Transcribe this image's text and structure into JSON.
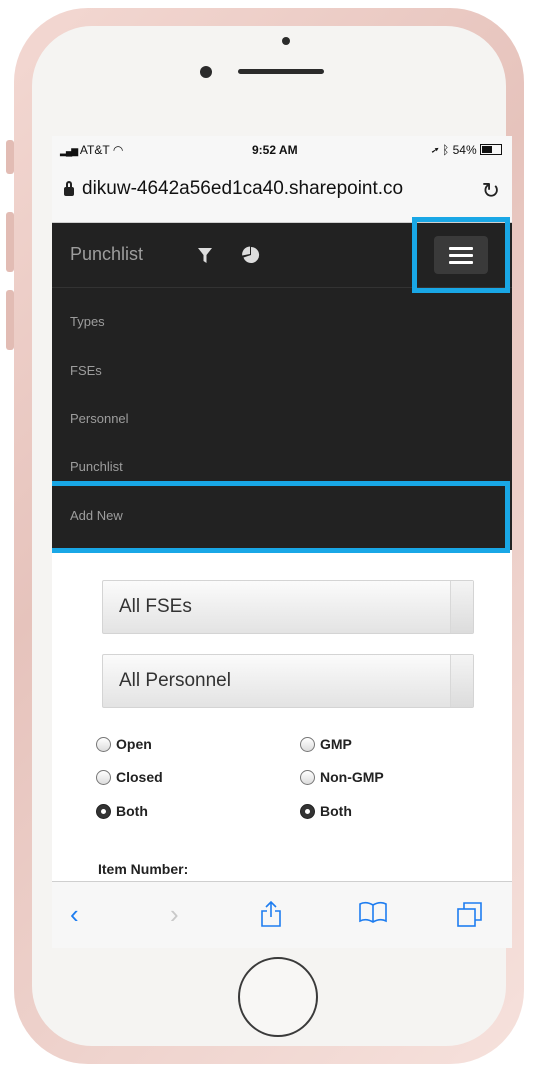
{
  "status_bar": {
    "carrier": "AT&T",
    "time": "9:52 AM",
    "battery": "54%"
  },
  "browser": {
    "url": "dikuw-4642a56ed1ca40.sharepoint.co"
  },
  "navbar": {
    "brand": "Punchlist",
    "icons": [
      "filter-icon",
      "pie-chart-icon",
      "hamburger-menu-icon"
    ]
  },
  "menu": {
    "items": [
      "Types",
      "FSEs",
      "Personnel",
      "Punchlist",
      "Add New"
    ]
  },
  "filters": {
    "fse_select": "All FSEs",
    "personnel_select": "All Personnel",
    "status_group": {
      "options": [
        "Open",
        "Closed",
        "Both"
      ],
      "selected": "Both"
    },
    "gmp_group": {
      "options": [
        "GMP",
        "Non-GMP",
        "Both"
      ],
      "selected": "Both"
    },
    "item_number_label": "Item Number:",
    "item_number_value": ""
  },
  "toolbar": {
    "icons": [
      "back-icon",
      "forward-icon",
      "share-icon",
      "bookmarks-icon",
      "tabs-icon"
    ]
  },
  "colors": {
    "navbar_bg": "#222222",
    "highlight": "#19a7e6",
    "ios_blue": "#1e7df0"
  }
}
